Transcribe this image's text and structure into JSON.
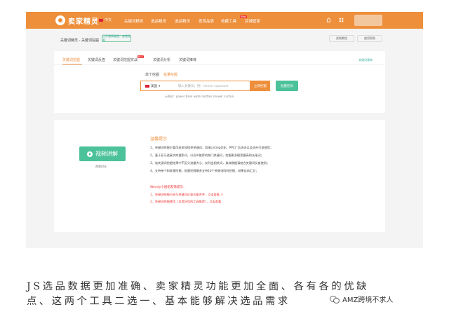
{
  "header": {
    "logo_text": "卖家精灵",
    "lang": "中文",
    "nav": [
      "关键词精灵",
      "选品精灵",
      "选品精灵",
      "查竞品表",
      "收藏工具",
      "店铺管家"
    ],
    "new_badge": "New"
  },
  "breadcrumb": {
    "text": "关键词精灵 - 关键词挖掘",
    "badge": "已开通高级版，查看权限",
    "buttons": [
      "视频教程",
      "使用帮助"
    ]
  },
  "tabs": {
    "items": [
      "关键词挖掘",
      "关键词反查",
      "关键词挖掘实战",
      "关键词分析",
      "关键词推荐"
    ],
    "new_badge": "New",
    "right_link": "关键词清单"
  },
  "search": {
    "modes": [
      "单个挖掘",
      "批量挖掘"
    ],
    "market": "美国",
    "placeholder": "输入关键词，例：lemon squeezer",
    "search_button": "立即挖掘",
    "bulk_button": "批量挖词",
    "examples": "示例词：power bank  water bottles  shower curtain"
  },
  "video": {
    "button": "视频讲解",
    "caption": "视频时长"
  },
  "tips": {
    "title": "温馨提示",
    "lines": [
      "1、关键词挖掘主要用来发现相关关键词，用来Listing优化、PPC广告选词以及站外引流使用；",
      "2、基于亚马逊真实的搜索词，以及AI推荐的热门关键词，挖掘更多搜索量高的长尾词；",
      "3、该关键词挖掘结果中不区分流量大小，仅列出相关词，具体数据请结合关键词反查使用；",
      "4、支持单个和批量挖掘，批量挖掘最多支持10个关键词同时挖掘，结果自动汇总；"
    ],
    "notice_title": "Wendy小姐姐友情提示：",
    "notice_lines": [
      "1、关键词挖掘已经与关键词反查功能合并，点击查看 >",
      "2、关键词挖掘使用（非常好用的工具推荐），点击查看"
    ]
  },
  "caption": {
    "line1": "JS选品数据更加准确、卖家精灵功能更加全面、各有各的优缺",
    "line2": "点、这两个工具二选一、基本能够解决选品需求"
  },
  "watermark": "AMZ跨境不求人"
}
